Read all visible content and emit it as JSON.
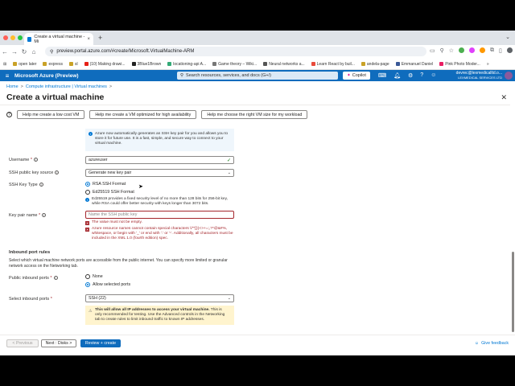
{
  "browser": {
    "tab_title": "Create a virtual machine - Mi",
    "tab_close": "×",
    "new_tab": "+",
    "url": "preview.portal.azure.com/#create/Microsoft.VirtualMachine-ARM",
    "bookmarks": [
      "open later",
      "express",
      "sl",
      "(10) Making drawi...",
      "3Blue1Brown",
      "locationing-api A...",
      "Game theory – Wiki...",
      "Neural networks a...",
      "Learn React by buil...",
      "andela-page",
      "Emmanuel Daniel",
      "Pink Photo Moder..."
    ],
    "bookmarks_more": "»"
  },
  "azure": {
    "product": "Microsoft Azure (Preview)",
    "search_placeholder": "Search resources, services, and docs (G+/)",
    "copilot": "Copilot",
    "user_name": "devrec@lexmedicalltd.o...",
    "user_org": "LEXMEDICAL SERVICES LTD"
  },
  "breadcrumb": {
    "home": "Home",
    "sep": ">",
    "infra": "Compute infrastructure | Virtual machines",
    "sep2": ">"
  },
  "page": {
    "title": "Create a virtual machine",
    "more": "···",
    "close": "✕"
  },
  "help": {
    "low_cost": "Help me create a low cost VM",
    "high_avail": "Help me create a VM optimized for high availability",
    "right_size": "Help me choose the right VM size for my workload"
  },
  "info_ssh": "Azure now automatically generates an SSH key pair for you and allows you to store it for future use. It is a fast, simple, and secure way to connect to your virtual machine.",
  "form": {
    "username_label": "Username",
    "username_value": "azureuser",
    "ssh_source_label": "SSH public key source",
    "ssh_source_value": "Generate new key pair",
    "key_type_label": "SSH Key Type",
    "key_type_rsa": "RSA SSH Format",
    "key_type_ed": "Ed25519 SSH Format",
    "key_type_note": "Ed25519 provides a fixed security level of no more than 128 bits for 256-bit key, while RSA could offer better security with keys longer than 3072 bits.",
    "key_pair_label": "Key pair name",
    "key_pair_placeholder": "Name the SSH public key",
    "err_empty": "The value must not be empty.",
    "err_chars": "Azure resource names cannot contain special characters \\/\"\"[]:|<>+=;,?*@&#%, whitespace, or begin with '_' or end with '.' or '-'. Additionally, all characters must be included in the XML 1.0 (fourth edition) spec."
  },
  "inbound": {
    "title": "Inbound port rules",
    "desc": "Select which virtual machine network ports are accessible from the public internet. You can specify more limited or granular network access on the Networking tab.",
    "public_label": "Public inbound ports",
    "opt_none": "None",
    "opt_allow": "Allow selected ports",
    "select_label": "Select inbound ports",
    "select_value": "SSH (22)",
    "warn_bold": "This will allow all IP addresses to access your virtual machine.",
    "warn_rest": " This is only recommended for testing. Use the Advanced controls in the Networking tab to create rules to limit inbound traffic to known IP addresses."
  },
  "footer": {
    "previous": "< Previous",
    "next": "Next : Disks >",
    "review": "Review + create",
    "feedback": "Give feedback"
  },
  "colors": {
    "azure_blue": "#0f6cbd",
    "error_red": "#a4262c",
    "link_blue": "#0078d4"
  }
}
